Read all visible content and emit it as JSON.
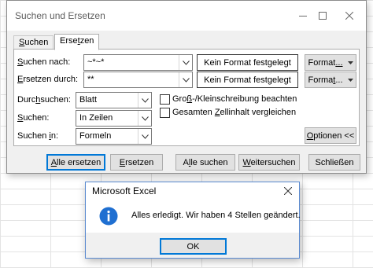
{
  "find_replace": {
    "title": "Suchen und Ersetzen",
    "tabs": [
      {
        "pre": "",
        "u": "S",
        "post": "uchen"
      },
      {
        "pre": "Erse",
        "u": "t",
        "post": "zen"
      }
    ],
    "find_label": {
      "pre": "",
      "u": "S",
      "post": "uchen nach:"
    },
    "find_value": "~*~*",
    "replace_label": {
      "pre": "",
      "u": "E",
      "post": "rsetzen durch:"
    },
    "replace_value": "**",
    "no_format": "Kein Format festgelegt",
    "format_button": {
      "pre": "Format",
      "u": "...",
      "post": ""
    },
    "format_button2": {
      "pre": "Forma",
      "u": "t",
      "post": "..."
    },
    "within_label": {
      "pre": "Durc",
      "u": "h",
      "post": "suchen:"
    },
    "within_value": "Blatt",
    "search_label": {
      "pre": "",
      "u": "S",
      "post": "uchen:"
    },
    "search_value": "In Zeilen",
    "lookin_label": {
      "pre": "Suchen ",
      "u": "i",
      "post": "n:"
    },
    "lookin_value": "Formeln",
    "match_case": {
      "pre": "Gro",
      "u": "ß",
      "post": "-/Kleinschreibung beachten"
    },
    "match_entire": {
      "pre": "Gesamten ",
      "u": "Z",
      "post": "ellinhalt vergleichen"
    },
    "options_button": {
      "pre": "",
      "u": "O",
      "post": "ptionen <<"
    },
    "replace_all": {
      "pre": "",
      "u": "A",
      "post": "lle ersetzen"
    },
    "replace": {
      "pre": "",
      "u": "E",
      "post": "rsetzen"
    },
    "find_all": {
      "pre": "A",
      "u": "l",
      "post": "le suchen"
    },
    "find_next": {
      "pre": "",
      "u": "W",
      "post": "eitersuchen"
    },
    "close": "Schließen"
  },
  "message_box": {
    "title": "Microsoft Excel",
    "text": "Alles erledigt. Wir haben 4 Stellen geändert.",
    "ok": "OK"
  }
}
